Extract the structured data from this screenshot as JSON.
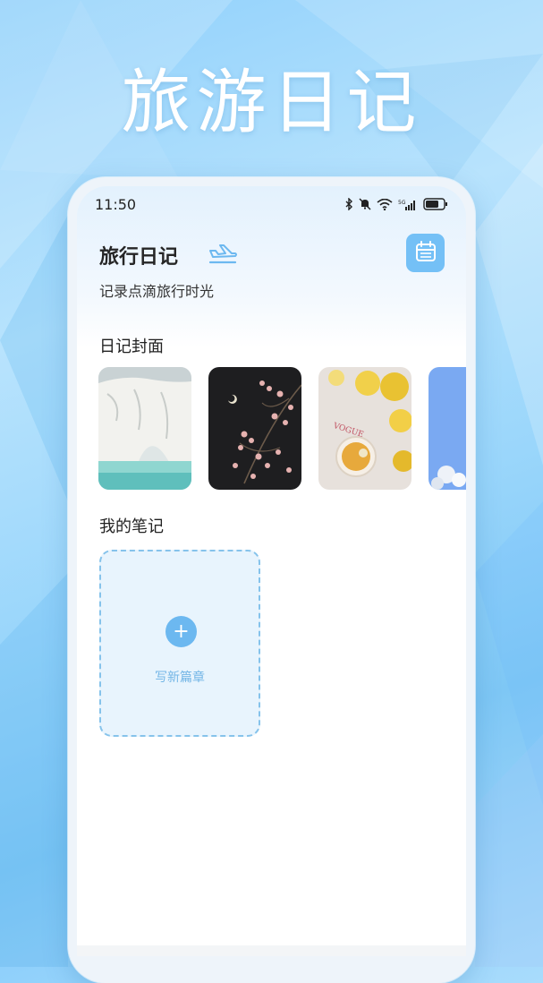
{
  "promo": {
    "title": "旅游日记"
  },
  "status_bar": {
    "time": "11:50",
    "icons": [
      "bluetooth-icon",
      "mute-icon",
      "wifi-icon",
      "signal-5g-icon",
      "battery-icon"
    ]
  },
  "header": {
    "title": "旅行日记",
    "subtitle": "记录点滴旅行时光",
    "title_icon": "plane-icon",
    "calendar_icon": "calendar-icon"
  },
  "covers": {
    "label": "日记封面",
    "items": [
      {
        "name": "cover-white-cliffs"
      },
      {
        "name": "cover-dark-blossom"
      },
      {
        "name": "cover-yellow-roses-tea",
        "text": "VOGUE"
      },
      {
        "name": "cover-blue-sky"
      }
    ]
  },
  "notes": {
    "label": "我的笔记",
    "add_label": "写新篇章",
    "add_icon": "+"
  },
  "colors": {
    "accent": "#74c0f6",
    "add_card_bg": "#e8f4fd",
    "add_card_border": "#86c3eb"
  }
}
